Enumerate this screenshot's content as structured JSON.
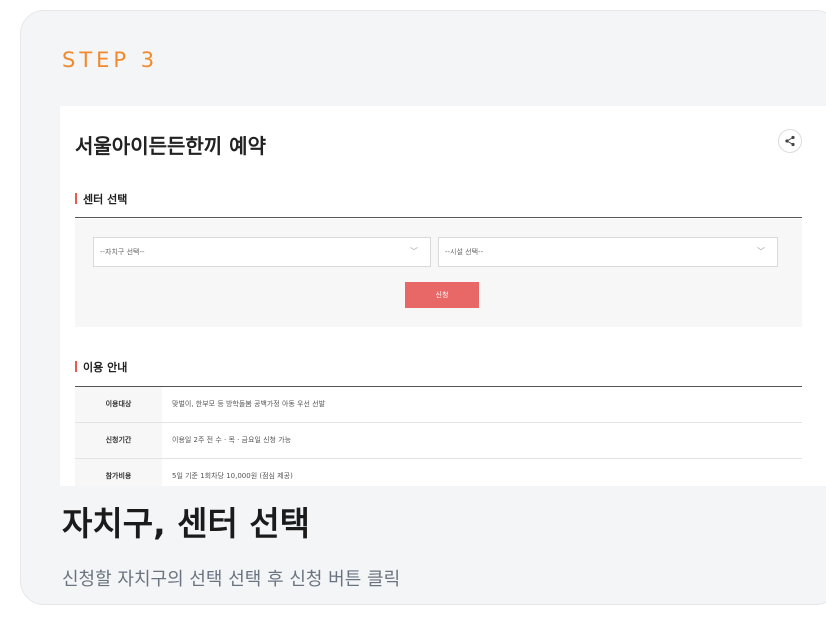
{
  "card": {
    "step_label": "STEP 3",
    "heading": "자치구, 센터 선택",
    "description": "신청할 자치구의 선택 선택 후 신청 버튼 클릭"
  },
  "screenshot": {
    "page_title": "서울아이든든한끼 예약",
    "share_icon": "share-icon",
    "center_section": {
      "title": "센터 선택",
      "district_select": {
        "value": "--자치구 선택--"
      },
      "facility_select": {
        "value": "--시설 선택--"
      },
      "apply_label": "신청"
    },
    "info_section": {
      "title": "이용 안내",
      "rows": [
        {
          "label": "이용대상",
          "value": "맞벌이, 한부모 등 방학돌봄 공백가정 아동 우선 선발"
        },
        {
          "label": "신청기간",
          "value": "이용일 2주 전 수 · 목 · 금요일 신청 가능"
        },
        {
          "label": "참가비용",
          "value": "5일 기준 1회차당 10,000원 (점심 제공)"
        }
      ]
    },
    "accent_color": "#e85a4f"
  }
}
